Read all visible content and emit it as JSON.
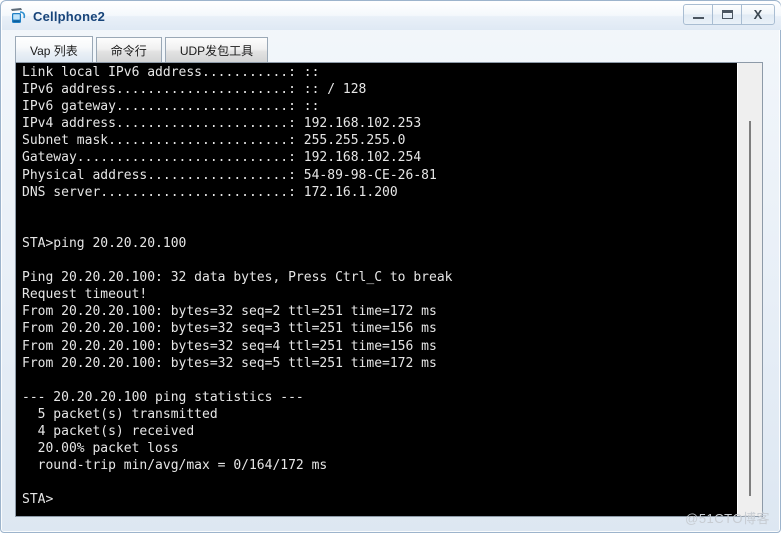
{
  "window": {
    "title": "Cellphone2",
    "icon": "cellphone-icon",
    "controls": {
      "minimize_label": "–",
      "maximize_label": "❐",
      "close_label": "X",
      "minimize_name": "minimize-button",
      "maximize_name": "maximize-button",
      "close_name": "close-button"
    }
  },
  "tabs": [
    {
      "label": "Vap 列表",
      "name": "tab-vap-list",
      "active": true
    },
    {
      "label": "命令行",
      "name": "tab-command-line",
      "active": false
    },
    {
      "label": "UDP发包工具",
      "name": "tab-udp-tool",
      "active": false
    }
  ],
  "console": {
    "info": [
      {
        "label": "Link local IPv6 address",
        "dots": "...........",
        "value": "::"
      },
      {
        "label": "IPv6 address",
        "dots": "......................",
        "value": ":: / 128"
      },
      {
        "label": "IPv6 gateway",
        "dots": "......................",
        "value": "::"
      },
      {
        "label": "IPv4 address",
        "dots": "......................",
        "value": "192.168.102.253"
      },
      {
        "label": "Subnet mask",
        "dots": ".......................",
        "value": "255.255.255.0"
      },
      {
        "label": "Gateway",
        "dots": "...........................",
        "value": "192.168.102.254"
      },
      {
        "label": "Physical address",
        "dots": "..................",
        "value": "54-89-98-CE-26-81"
      },
      {
        "label": "DNS server",
        "dots": "........................",
        "value": "172.16.1.200"
      }
    ],
    "prompt": "STA>",
    "command": "ping 20.20.20.100",
    "ping_header": "Ping 20.20.20.100: 32 data bytes, Press Ctrl_C to break",
    "timeout_line": "Request timeout!",
    "replies": [
      "From 20.20.20.100: bytes=32 seq=2 ttl=251 time=172 ms",
      "From 20.20.20.100: bytes=32 seq=3 ttl=251 time=156 ms",
      "From 20.20.20.100: bytes=32 seq=4 ttl=251 time=156 ms",
      "From 20.20.20.100: bytes=32 seq=5 ttl=251 time=172 ms"
    ],
    "stats_header": "--- 20.20.20.100 ping statistics ---",
    "stats": [
      "  5 packet(s) transmitted",
      "  4 packet(s) received",
      "  20.00% packet loss",
      "  round-trip min/avg/max = 0/164/172 ms"
    ],
    "final_prompt": "STA>",
    "full_text": "Link local IPv6 address...........: ::\nIPv6 address......................: :: / 128\nIPv6 gateway......................: ::\nIPv4 address......................: 192.168.102.253\nSubnet mask.......................: 255.255.255.0\nGateway...........................: 192.168.102.254\nPhysical address..................: 54-89-98-CE-26-81\nDNS server........................: 172.16.1.200\n\n\nSTA>ping 20.20.20.100\n\nPing 20.20.20.100: 32 data bytes, Press Ctrl_C to break\nRequest timeout!\nFrom 20.20.20.100: bytes=32 seq=2 ttl=251 time=172 ms\nFrom 20.20.20.100: bytes=32 seq=3 ttl=251 time=156 ms\nFrom 20.20.20.100: bytes=32 seq=4 ttl=251 time=156 ms\nFrom 20.20.20.100: bytes=32 seq=5 ttl=251 time=172 ms\n\n--- 20.20.20.100 ping statistics ---\n  5 packet(s) transmitted\n  4 packet(s) received\n  20.00% packet loss\n  round-trip min/avg/max = 0/164/172 ms\n\nSTA>"
  },
  "watermark": {
    "text": "@51CTO博客"
  },
  "colors": {
    "title_text": "#17447a",
    "console_bg": "#000000",
    "console_fg": "#e6e6e6",
    "frame": "#9db4cc",
    "watermark": "#c7ccd2"
  }
}
